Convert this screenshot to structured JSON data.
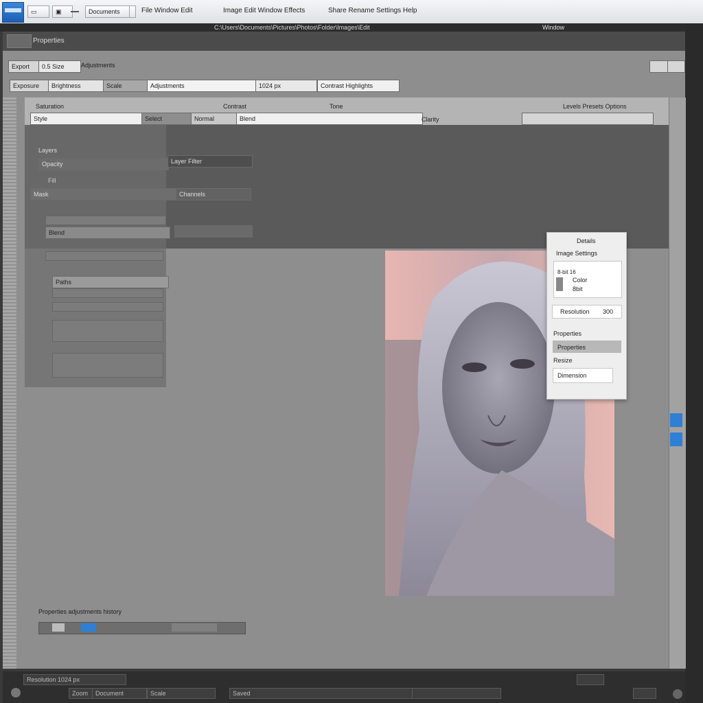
{
  "menubar": {
    "btn_1": "Documents",
    "menu_1": "File Window Edit",
    "menu_2": "Image Edit Window Effects",
    "menu_3": "Share Rename",
    "menu_4": "Settings Help"
  },
  "titlebar": {
    "path": "C:\\Users\\Documents\\Pictures\\Photos\\Folder\\Images\\Edit",
    "window_title": "Window"
  },
  "panel": {
    "title": "Properties"
  },
  "toolbar": {
    "field_1": "Export",
    "field_1_value": "0.5 Size",
    "label_1": "Adjustments",
    "tab_1": "Exposure",
    "tab_2": "Brightness",
    "tab_3": "Scale",
    "search_value": "Adjustments",
    "size_value": "1024 px",
    "preset": "Contrast Highlights"
  },
  "columns": {
    "h1": "Saturation",
    "h2": "Contrast",
    "h3": "Tone",
    "h4": "Levels Presets Options",
    "c1": "Style",
    "c2": "Select",
    "c3": "Normal",
    "c4": "Blend",
    "c5": "Clarity"
  },
  "left_panel": {
    "l1": "Layers",
    "l2": "Opacity",
    "l3": "Layer Filter",
    "l4": "Fill",
    "l5": "Mask",
    "l6": "Channels",
    "l7": "Blend",
    "l8": "Paths"
  },
  "props": {
    "title": "Details",
    "heading": "Image Settings",
    "v1": "8-bit 16",
    "v2": "Color",
    "v3": "8bit",
    "size_label": "Resolution",
    "size_value": "300",
    "group1": "Properties",
    "selected": "Properties",
    "group2": "Resize",
    "input": "Dimension"
  },
  "bottom_strip": {
    "caption": "Properties adjustments history"
  },
  "status": {
    "s1": "Resolution 1024 px",
    "s2": "Zoom",
    "s3": "Document",
    "s4": "Scale",
    "s5": "Saved"
  }
}
